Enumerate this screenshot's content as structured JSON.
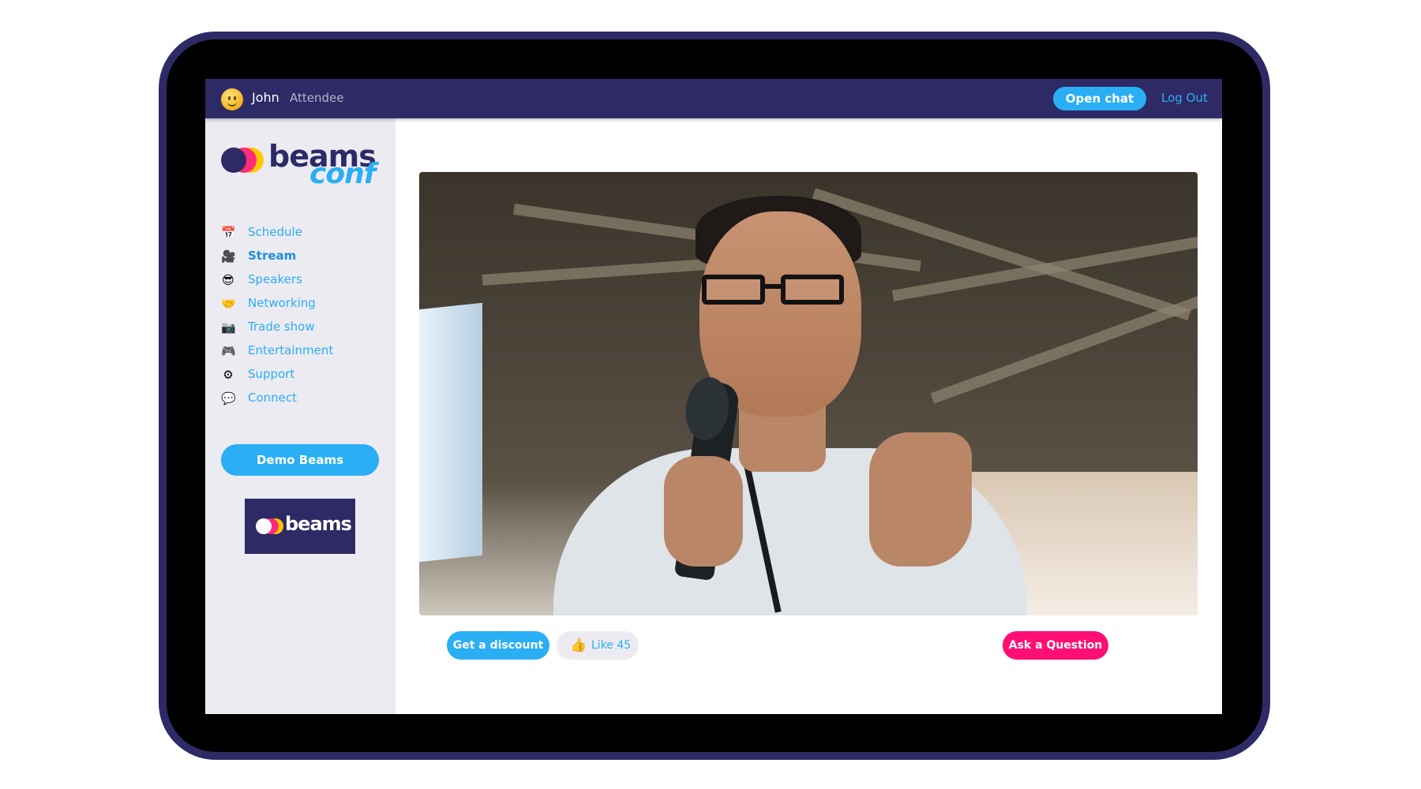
{
  "user": {
    "name": "John",
    "role": "Attendee"
  },
  "header": {
    "open_chat_label": "Open chat",
    "logout_label": "Log Out"
  },
  "sidebar": {
    "logo_word1": "beams",
    "logo_word2": "conf",
    "items": [
      {
        "label": "Schedule",
        "icon": "calendar-icon",
        "active": false
      },
      {
        "label": "Stream",
        "icon": "video-camera-icon",
        "active": true
      },
      {
        "label": "Speakers",
        "icon": "sunglasses-face-icon",
        "active": false
      },
      {
        "label": "Networking",
        "icon": "handshake-icon",
        "active": false
      },
      {
        "label": "Trade show",
        "icon": "camera-icon",
        "active": false
      },
      {
        "label": "Entertainment",
        "icon": "gamepad-icon",
        "active": false
      },
      {
        "label": "Support",
        "icon": "gear-icon",
        "active": false
      },
      {
        "label": "Connect",
        "icon": "speech-bubble-icon",
        "active": false
      }
    ],
    "demo_button_label": "Demo Beams",
    "badge_text": "beams"
  },
  "stream": {
    "video": "speaker-photo"
  },
  "actions": {
    "discount_label": "Get a discount",
    "like_label": "Like 45",
    "ask_label": "Ask a Question"
  },
  "colors": {
    "brand_navy": "#2e2a66",
    "accent_blue": "#2aaef4",
    "accent_pink": "#ff0f74",
    "sidebar_bg": "#ecebf2"
  }
}
